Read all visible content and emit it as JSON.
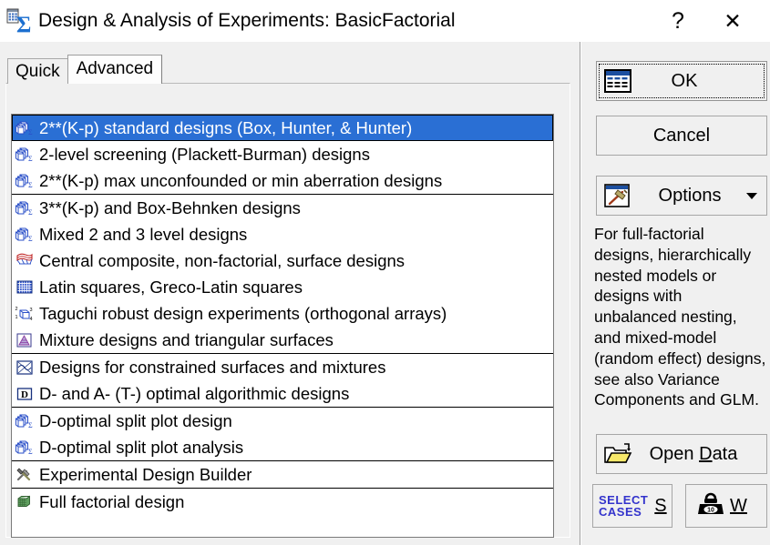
{
  "window": {
    "title": "Design & Analysis of Experiments: BasicFactorial",
    "icon": "sigma-spreadsheet-icon",
    "help_label": "?",
    "close_label": "✕"
  },
  "tabs": [
    {
      "label": "Quick",
      "selected": false
    },
    {
      "label": "Advanced",
      "selected": true
    }
  ],
  "list_groups": [
    {
      "items": [
        {
          "label": "2**(K-p) standard designs (Box, Hunter, & Hunter)",
          "icon": "cube-stack-icon",
          "selected": true
        },
        {
          "label": "2-level screening (Plackett-Burman) designs",
          "icon": "cube-stack-icon",
          "selected": false
        },
        {
          "label": "2**(K-p) max unconfounded or min aberration designs",
          "icon": "cube-stack-icon",
          "selected": false
        }
      ]
    },
    {
      "items": [
        {
          "label": "3**(K-p) and Box-Behnken designs",
          "icon": "cube-stack-icon",
          "selected": false
        },
        {
          "label": "Mixed 2 and 3 level designs",
          "icon": "cube-stack-icon",
          "selected": false
        },
        {
          "label": "Central composite, non-factorial, surface designs",
          "icon": "surface-contour-icon",
          "selected": false
        },
        {
          "label": "Latin squares, Greco-Latin squares",
          "icon": "grid-square-icon",
          "selected": false
        },
        {
          "label": "Taguchi robust design experiments (orthogonal arrays)",
          "icon": "taguchi-cube-icon",
          "selected": false
        },
        {
          "label": "Mixture designs and triangular surfaces",
          "icon": "mixture-triangle-icon",
          "selected": false
        }
      ]
    },
    {
      "items": [
        {
          "label": "Designs for constrained surfaces and mixtures",
          "icon": "constrained-surface-icon",
          "selected": false
        },
        {
          "label": "D- and A- (T-) optimal algorithmic designs",
          "icon": "letter-d-icon",
          "selected": false
        }
      ]
    },
    {
      "items": [
        {
          "label": "D-optimal split plot design",
          "icon": "cube-stack-icon",
          "selected": false
        },
        {
          "label": "D-optimal split plot analysis",
          "icon": "cube-stack-icon",
          "selected": false
        }
      ]
    },
    {
      "items": [
        {
          "label": "Experimental Design Builder",
          "icon": "hammer-wrench-icon",
          "selected": false
        }
      ]
    },
    {
      "items": [
        {
          "label": "Full factorial design",
          "icon": "green-cube-icon",
          "selected": false
        }
      ]
    }
  ],
  "buttons": {
    "ok": {
      "label": "OK",
      "icon": "spreadsheet-icon",
      "focused": true
    },
    "cancel": {
      "label": "Cancel"
    },
    "options": {
      "label": "Options",
      "icon": "hammer-icon",
      "caret": "chevron-down-icon"
    },
    "open_data": {
      "label_pre": "Open ",
      "label_hotkey": "D",
      "label_post": "ata",
      "icon": "open-folder-icon"
    },
    "select_cases": {
      "line1": "SELECT",
      "line2": "CASES",
      "hotkey": "S"
    },
    "weight": {
      "hotkey": "W",
      "icon": "weight-icon"
    }
  },
  "description": "For full-factorial designs, hierarchically nested models or designs with unbalanced nesting, and mixed-model (random effect) designs, see also Variance Components and GLM.",
  "colors": {
    "selection_blue": "#2a6fd4",
    "window_gray": "#f0f0f0",
    "listbox_white": "#ffffff",
    "icon_blue": "#2a4fc8",
    "select_cases_blue": "#3333cc"
  }
}
